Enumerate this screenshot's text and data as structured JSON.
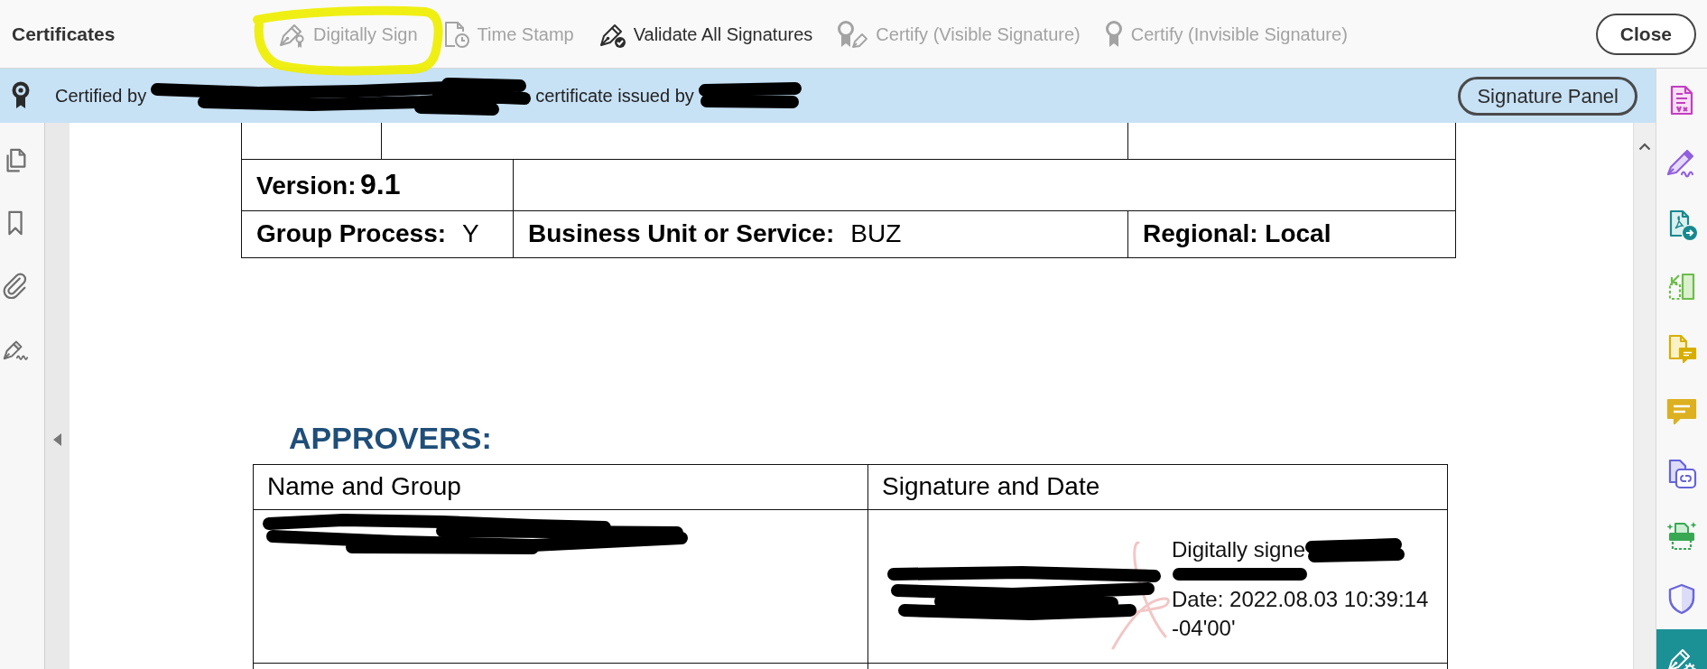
{
  "toolbar": {
    "title": "Certificates",
    "tools": [
      {
        "kind": "sign",
        "label": "Digitally Sign",
        "disabled": true,
        "highlighted": true
      },
      {
        "kind": "timestamp",
        "label": "Time Stamp",
        "disabled": true,
        "highlighted": false
      },
      {
        "kind": "validate",
        "label": "Validate All Signatures",
        "disabled": false,
        "highlighted": false
      },
      {
        "kind": "certify-visible",
        "label": "Certify (Visible Signature)",
        "disabled": true,
        "highlighted": false
      },
      {
        "kind": "certify-invisible",
        "label": "Certify (Invisible Signature)",
        "disabled": true,
        "highlighted": false
      }
    ],
    "close_button": "Close"
  },
  "banner": {
    "segments": [
      {
        "kind": "text",
        "text": "Certified by"
      },
      {
        "kind": "redaction"
      },
      {
        "kind": "text",
        "text": "certificate issued by"
      },
      {
        "kind": "redaction"
      }
    ],
    "button": "Signature Panel"
  },
  "left_panel": {
    "items": [
      {
        "kind": "pages"
      },
      {
        "kind": "bookmarks"
      },
      {
        "kind": "attachments"
      },
      {
        "kind": "signatures"
      }
    ]
  },
  "document": {
    "details_table": {
      "version_label": "Version:",
      "version": "9.1",
      "group_process_label": "Group Process:",
      "group_process": "Y",
      "business_unit_label": "Business Unit or Service:",
      "business_unit": "BUZ",
      "regional": "Regional: Local"
    },
    "approvers_heading": "APPROVERS:",
    "approvers_table": {
      "columns": [
        "Name and Group",
        "Signature and Date"
      ],
      "rows": [
        {
          "name_redacted": true,
          "signature_lines": [
            "Digitally signe",
            "Date: 2022.08.03 10:39:14",
            "-04'00'"
          ],
          "signature_redacted": true
        }
      ]
    }
  },
  "right_toolbar": {
    "tools": [
      {
        "kind": "fill-sign",
        "selected": false
      },
      {
        "kind": "request-signature",
        "selected": false
      },
      {
        "kind": "export",
        "selected": false
      },
      {
        "kind": "organize",
        "selected": false
      },
      {
        "kind": "comment-document",
        "selected": false
      },
      {
        "kind": "comment",
        "selected": false
      },
      {
        "kind": "share",
        "selected": false
      },
      {
        "kind": "scan",
        "selected": false
      },
      {
        "kind": "protect",
        "selected": false
      },
      {
        "kind": "certificates",
        "selected": true
      }
    ]
  }
}
